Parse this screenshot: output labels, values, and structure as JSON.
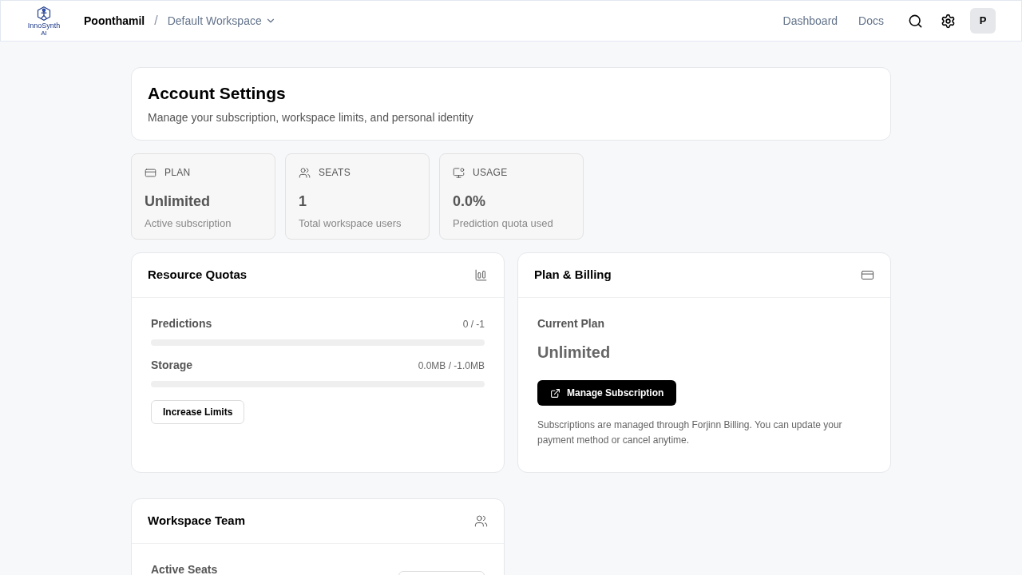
{
  "nav": {
    "logo_text": "InnoSynth",
    "logo_subtext": "AI",
    "user": "Poonthamil",
    "separator": "/",
    "workspace": "Default Workspace",
    "links": [
      "Dashboard",
      "Docs"
    ],
    "avatar": "P"
  },
  "header": {
    "title": "Account Settings",
    "subtitle": "Manage your subscription, workspace limits, and personal identity"
  },
  "stats": [
    {
      "kind": "plan",
      "label": "PLAN",
      "value": "Unlimited",
      "caption": "Active subscription"
    },
    {
      "kind": "seats",
      "label": "SEATS",
      "value": "1",
      "caption": "Total workspace users"
    },
    {
      "kind": "usage",
      "label": "USAGE",
      "value": "0.0%",
      "caption": "Prediction quota used"
    }
  ],
  "quotas": {
    "title": "Resource Quotas",
    "items": [
      {
        "name": "Predictions",
        "reading": "0 / -1",
        "level": 0
      },
      {
        "name": "Storage",
        "reading": "0.0MB / -1.0MB",
        "level": 0
      }
    ],
    "button": "Increase Limits"
  },
  "billing": {
    "title": "Plan & Billing",
    "label": "Current Plan",
    "plan": "Unlimited",
    "button": "Manage Subscription",
    "note": "Subscriptions are managed through Forjinn Billing. You can update your payment method or cancel anytime."
  },
  "team": {
    "title": "Workspace Team",
    "label": "Active Seats"
  }
}
